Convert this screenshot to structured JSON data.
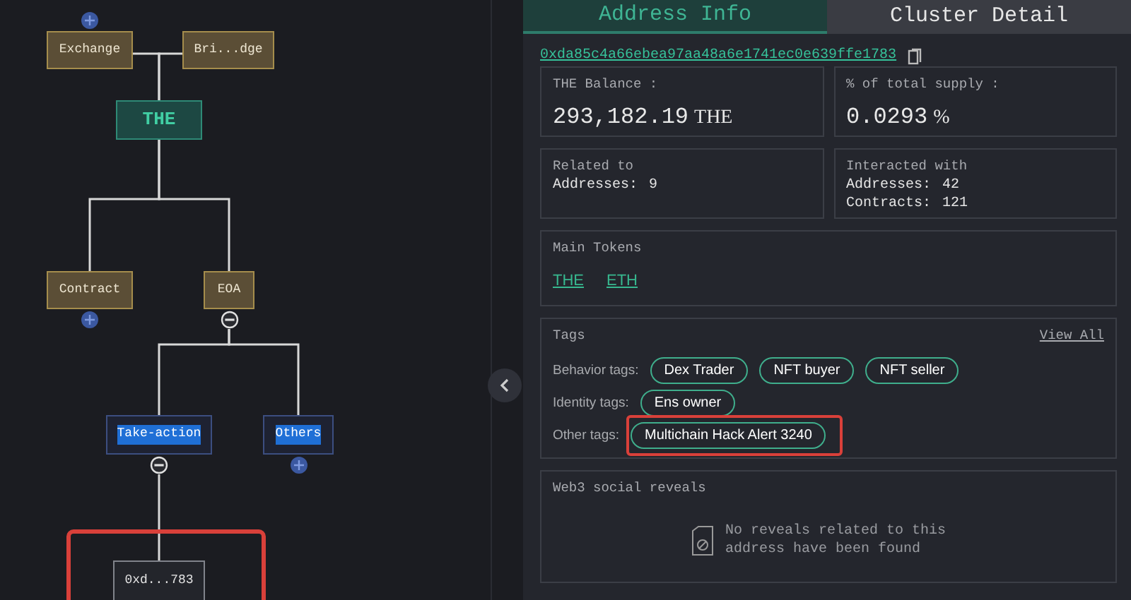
{
  "diagram": {
    "root": {
      "label": "THE",
      "kind": "token",
      "upstream": [
        {
          "label": "Exchange",
          "kind": "category",
          "expanded": false
        },
        {
          "label": "Bri...dge",
          "kind": "category"
        }
      ],
      "children": [
        {
          "label": "Contract",
          "kind": "category",
          "expanded": false
        },
        {
          "label": "EOA",
          "kind": "category",
          "expanded": true,
          "children": [
            {
              "label": "Take-action",
              "kind": "group",
              "highlighted": true,
              "expanded": true,
              "children": [
                {
                  "label": "0xd...783",
                  "kind": "address",
                  "boxed": true
                }
              ]
            },
            {
              "label": "Others",
              "kind": "group",
              "highlighted": true,
              "expanded": false
            }
          ]
        }
      ]
    }
  },
  "tabs": [
    {
      "label": "Address Info",
      "selected": true
    },
    {
      "label": "Cluster Detail",
      "selected": false
    }
  ],
  "address": "0xda85c4a66ebea97aa48a6e1741ec0e639ffe1783",
  "stats": [
    {
      "label": "THE Balance :",
      "value": "293,182.19",
      "unit": "THE"
    },
    {
      "label": "% of total supply :",
      "value": "0.0293",
      "unit": "%"
    }
  ],
  "relations": [
    {
      "label": "Related to",
      "lines": [
        {
          "key": "Addresses:",
          "value": "9"
        }
      ]
    },
    {
      "label": "Interacted with",
      "lines": [
        {
          "key": "Addresses:",
          "value": "42"
        },
        {
          "key": "Contracts:",
          "value": "121"
        }
      ]
    }
  ],
  "main_tokens": {
    "title": "Main Tokens",
    "tokens": [
      "THE",
      "ETH"
    ]
  },
  "tags": {
    "title": "Tags",
    "view_all": "View All",
    "groups": [
      {
        "label": "Behavior tags:",
        "tags": [
          "Dex Trader",
          "NFT buyer",
          "NFT seller"
        ]
      },
      {
        "label": "Identity tags:",
        "tags": [
          "Ens owner"
        ]
      },
      {
        "label": "Other tags:",
        "tags": [
          "Multichain Hack Alert 3240"
        ],
        "boxed": true
      }
    ]
  },
  "social": {
    "title": "Web3 social reveals",
    "empty_message": "No reveals related to this address have been found"
  }
}
